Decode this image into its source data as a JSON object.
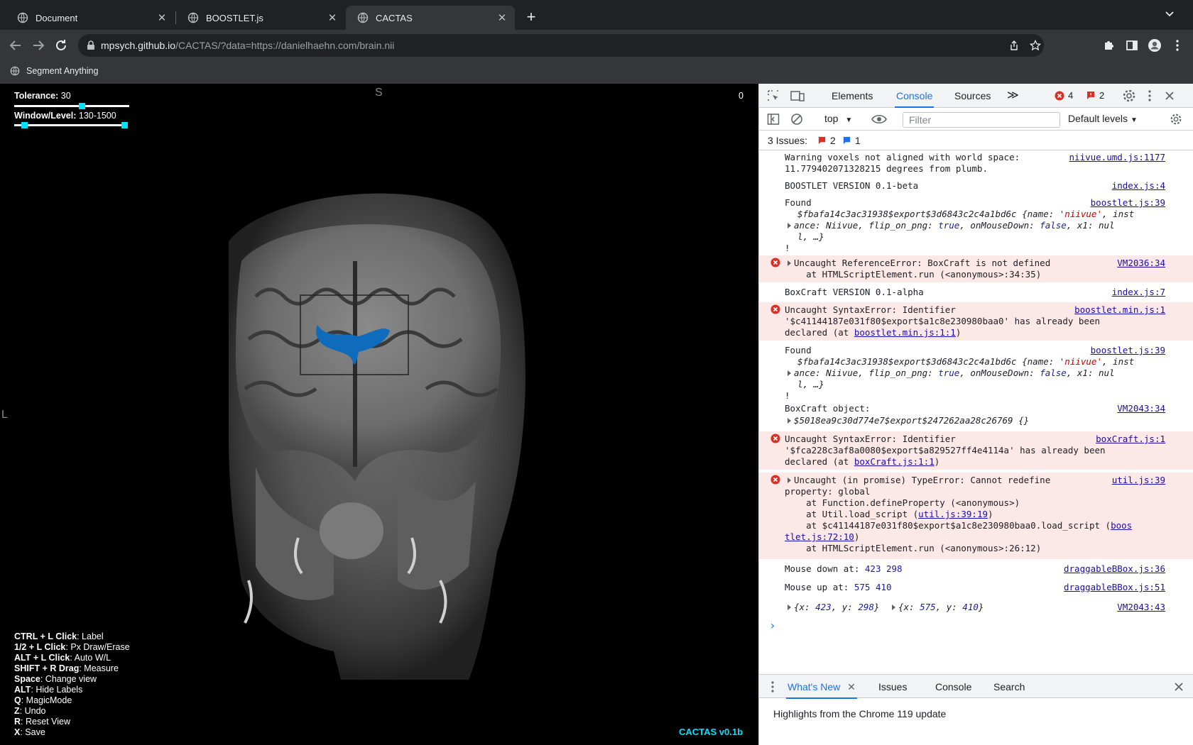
{
  "tabs": [
    {
      "title": "Document"
    },
    {
      "title": "BOOSTLET.js"
    },
    {
      "title": "CACTAS"
    }
  ],
  "address": {
    "host": "mpsych.github.io",
    "path": "/CACTAS/?data=https://danielhaehn.com/brain.nii"
  },
  "bookmarks": [
    {
      "label": "Segment Anything"
    }
  ],
  "viewer": {
    "tolerance_label": "Tolerance:",
    "tolerance_value": "30",
    "wl_label": "Window/Level:",
    "wl_value": "130-1500",
    "orient_top": "S",
    "orient_left": "L",
    "corner_value": "0",
    "help": [
      {
        "key": "CTRL + L Click",
        "desc": ": Label"
      },
      {
        "key": "1/2 + L Click",
        "desc": ": Px Draw/Erase"
      },
      {
        "key": "ALT + L Click",
        "desc": ": Auto W/L"
      },
      {
        "key": "SHIFT + R Drag",
        "desc": ": Measure"
      },
      {
        "key": "Space",
        "desc": ": Change view"
      },
      {
        "key": "ALT",
        "desc": ": Hide Labels"
      },
      {
        "key": "Q",
        "desc": ": MagicMode"
      },
      {
        "key": "Z",
        "desc": ": Undo"
      },
      {
        "key": "R",
        "desc": ": Reset View"
      },
      {
        "key": "X",
        "desc": ": Save"
      }
    ],
    "version": "CACTAS v0.1b",
    "label_color": "#0f6cbd",
    "knob_color": "#00e0ff"
  },
  "devtools": {
    "tabs": [
      "Elements",
      "Console",
      "Sources"
    ],
    "more": "≫",
    "error_count": "4",
    "issue_count": "2",
    "context": "top",
    "filter_placeholder": "Filter",
    "levels": "Default levels",
    "issues_label": "3 Issues:",
    "issues_err": "2",
    "issues_info": "1",
    "console": {
      "m1_l1": "Warning voxels not aligned with world space:",
      "m1_l2": "11.779402071328215 degrees from plumb.",
      "m1_src": "niivue.umd.js:1177",
      "m2": "BOOSTLET VERSION 0.1-beta",
      "m2_src": "index.js:4",
      "m3_l1": "Found",
      "m3_obj": "$fbafa14c3ac31938$export$3d6843c2c4a1bd6c",
      "m3_name_key": "{name: ",
      "m3_name_val": "'niivue'",
      "m3_inst": ", inst",
      "m3_l3a": "ance: Niivue, flip_on_png: ",
      "m3_true": "true",
      "m3_mid": ", onMouseDown: ",
      "m3_false": "false",
      "m3_x1": ", x1: nul",
      "m3_l4": "l, …}",
      "m3_l5": "!",
      "m3_src": "boostlet.js:39",
      "e1_l1": "Uncaught ReferenceError: BoxCraft is not defined",
      "e1_l2": "    at HTMLScriptElement.run (<anonymous>:34:35)",
      "e1_src": "VM2036:34",
      "m4": "BoxCraft VERSION 0.1-alpha",
      "m4_src": "index.js:7",
      "e2_l1": "Uncaught SyntaxError: Identifier",
      "e2_l2": "'$c41144187e031f80$export$a1c8e230980baa0' has already been",
      "e2_l3a": "declared (at ",
      "e2_l3link": "boostlet.min.js:1:1",
      "e2_l3b": ")",
      "e2_src": "boostlet.min.js:1",
      "m5_src": "boostlet.js:39",
      "m6_l1": "BoxCraft object:",
      "m6_l2": "$5018ea9c30d774e7$export$247262aa28c26769 {}",
      "m6_src": "VM2043:34",
      "e3_l1": "Uncaught SyntaxError: Identifier",
      "e3_l2": "'$fca228c3af8a0080$export$a829527ff4e4114a' has already been",
      "e3_l3a": "declared (at ",
      "e3_l3link": "boxCraft.js:1:1",
      "e3_l3b": ")",
      "e3_src": "boxCraft.js:1",
      "e4_l1": "Uncaught (in promise) TypeError: Cannot redefine",
      "e4_l2": "property: global",
      "e4_l3": "    at Function.defineProperty (<anonymous>)",
      "e4_l4a": "    at Util.load_script (",
      "e4_l4link": "util.js:39:19",
      "e4_l4b": ")",
      "e4_l5a": "    at $c41144187e031f80$export$a1c8e230980baa0.load_script (",
      "e4_l5link1": "boos",
      "e4_l6link2": "tlet.js:72:10",
      "e4_l6b": ")",
      "e4_l7": "    at HTMLScriptElement.run (<anonymous>:26:12)",
      "e4_src": "util.js:39",
      "m7_label": "Mouse down at: ",
      "m7_val": "423 298",
      "m7_src": "draggableBBox.js:36",
      "m8_label": "Mouse up at: ",
      "m8_val": "575 410",
      "m8_src": "draggableBBox.js:51",
      "m9_a": "{x: ",
      "m9_ax": "423",
      "m9_ay_l": ", y: ",
      "m9_ay": "298",
      "m9_close": "}",
      "m9_b": "{x: ",
      "m9_bx": "575",
      "m9_by": "410",
      "m9_src": "VM2043:43",
      "prompt": "›"
    },
    "drawer": {
      "tabs": [
        "What's New",
        "Issues",
        "Console",
        "Search"
      ],
      "content": "Highlights from the Chrome 119 update"
    }
  }
}
